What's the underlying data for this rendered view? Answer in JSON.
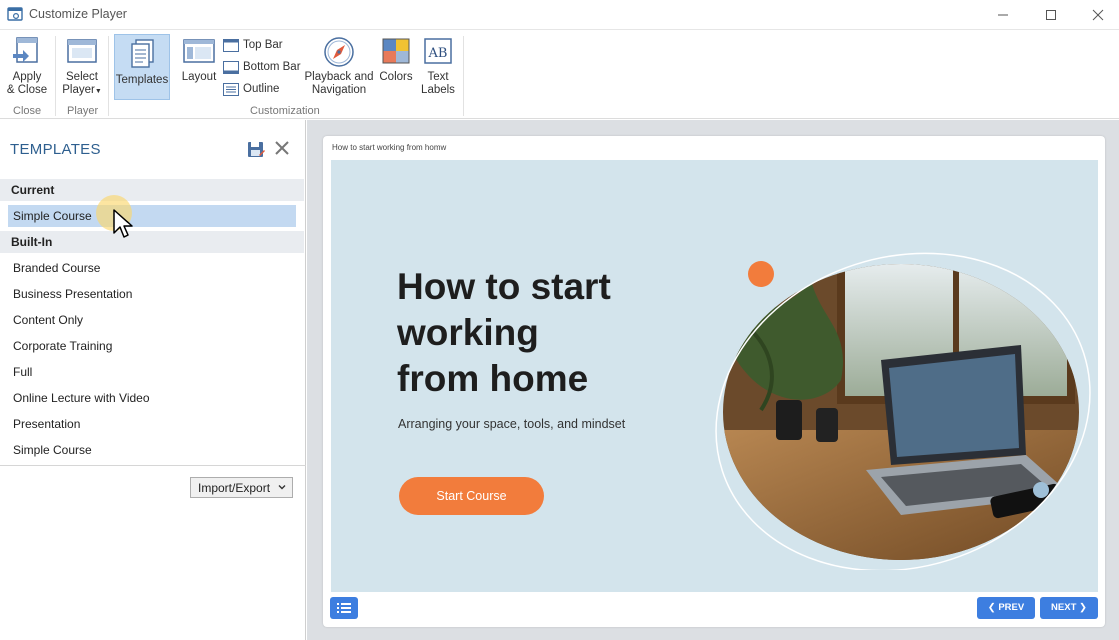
{
  "window": {
    "title": "Customize Player",
    "controls": [
      "minimize-icon",
      "maximize-icon",
      "close-icon"
    ]
  },
  "ribbon": {
    "apply_close_line1": "Apply",
    "apply_close_line2": "& Close",
    "select_player_line1": "Select",
    "select_player_line2": "Player",
    "templates": "Templates",
    "layout": "Layout",
    "top_bar": "Top Bar",
    "bottom_bar": "Bottom Bar",
    "outline": "Outline",
    "playback_line1": "Playback and",
    "playback_line2": "Navigation",
    "colors": "Colors",
    "text_labels_line1": "Text",
    "text_labels_line2": "Labels",
    "groups": {
      "close": "Close",
      "player": "Player",
      "customization": "Customization"
    }
  },
  "templates_panel": {
    "title": "TEMPLATES",
    "current_header": "Current",
    "current_items": [
      "Simple Course"
    ],
    "builtin_header": "Built-In",
    "builtin_items": [
      "Branded Course",
      "Business Presentation",
      "Content Only",
      "Corporate Training",
      "Full",
      "Online Lecture with Video",
      "Presentation",
      "Simple Course"
    ],
    "import_export": "Import/Export"
  },
  "preview": {
    "player_title": "How to start working from homw",
    "slide_heading": "How to start\nworking\nfrom home",
    "slide_subtitle": "Arranging your space, tools, and mindset",
    "start_button": "Start Course",
    "prev_button": "❮ PREV",
    "next_button": "NEXT ❯"
  },
  "colors": {
    "accent_blue": "#3d7ee0",
    "slide_bg": "#d3e4ec",
    "start_orange": "#f27c3c",
    "selected_row": "#c3d9f1",
    "panel_title": "#2e5f8f"
  }
}
